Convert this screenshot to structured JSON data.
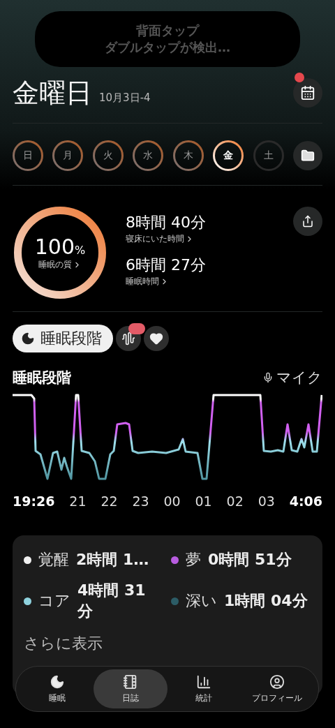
{
  "notification": {
    "lines": [
      "背面タップ",
      "ダブルタップが検出…"
    ]
  },
  "header": {
    "title": "金曜日",
    "date": "10月3日-4",
    "calendar_badge": true
  },
  "days": [
    {
      "label": "日",
      "recorded": true,
      "selected": false
    },
    {
      "label": "月",
      "recorded": true,
      "selected": false
    },
    {
      "label": "火",
      "recorded": true,
      "selected": false
    },
    {
      "label": "水",
      "recorded": true,
      "selected": false
    },
    {
      "label": "木",
      "recorded": true,
      "selected": false
    },
    {
      "label": "金",
      "recorded": true,
      "selected": true
    },
    {
      "label": "土",
      "recorded": false,
      "selected": false
    }
  ],
  "summary": {
    "quality": {
      "value": "100",
      "unit": "%",
      "label": "睡眠の質"
    },
    "stats": [
      {
        "value": "8時間 40分",
        "label": "寝床にいた時間"
      },
      {
        "value": "6時間 27分",
        "label": "睡眠時間"
      }
    ]
  },
  "view_tabs": [
    {
      "kind": "label",
      "label": "睡眠段階",
      "selected": true
    },
    {
      "kind": "sound",
      "selected": false,
      "badge": true
    },
    {
      "kind": "heart",
      "selected": false
    }
  ],
  "chart": {
    "title": "睡眠段階",
    "source": "マイク",
    "time_labels": [
      "19:26",
      "21",
      "22",
      "23",
      "00",
      "01",
      "02",
      "03",
      "4:06"
    ]
  },
  "legend": [
    {
      "name": "覚醒",
      "value": "2時間 1…",
      "color": "#f0f0f0"
    },
    {
      "name": "夢",
      "value": "0時間 51分",
      "color": "#b85ce0"
    },
    {
      "name": "コア",
      "value": "4時間 31 分",
      "color": "#8fd2de"
    },
    {
      "name": "深い",
      "value": "1時間 04分",
      "color": "#2c5c66"
    }
  ],
  "more": "さらに表示",
  "nav": [
    {
      "kind": "moon",
      "label": "睡眠",
      "selected": false
    },
    {
      "kind": "journal",
      "label": "日誌",
      "selected": true
    },
    {
      "kind": "stats",
      "label": "統計",
      "selected": false
    },
    {
      "kind": "profile",
      "label": "プロフィール",
      "selected": false
    }
  ]
}
